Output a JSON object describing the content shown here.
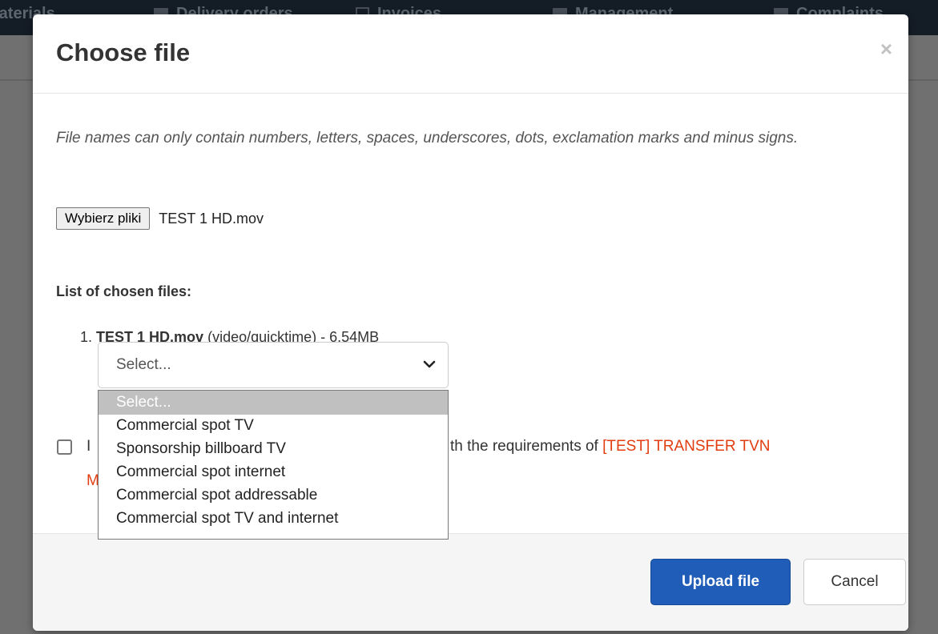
{
  "background_nav": {
    "items": [
      {
        "label": "Materials"
      },
      {
        "label": "Delivery orders"
      },
      {
        "label": "Invoices"
      },
      {
        "label": "Management"
      },
      {
        "label": "Complaints"
      }
    ]
  },
  "modal": {
    "title": "Choose file",
    "close_symbol": "×",
    "hint": "File names can only contain numbers, letters, spaces, underscores, dots, exclamation marks and minus signs.",
    "file_input": {
      "button_label": "Wybierz pliki",
      "chosen_name": "TEST 1 HD.mov"
    },
    "list_title": "List of chosen files:",
    "files": [
      {
        "index": "1.",
        "name": "TEST 1 HD.mov",
        "meta": "(video/quicktime) - 6.54MB",
        "type_select": {
          "selected": "Select...",
          "options": [
            "Select...",
            "Commercial spot TV",
            "Sponsorship billboard TV",
            "Commercial spot internet",
            "Commercial spot addressable",
            "Commercial spot TV and internet"
          ]
        }
      }
    ],
    "consent": {
      "visible_start": "I",
      "visible_middle": "th the requirements of",
      "link_text": "[TEST] TRANSFER TVN",
      "visible_second_line": "M"
    },
    "footer": {
      "upload_label": "Upload file",
      "cancel_label": "Cancel"
    }
  },
  "colors": {
    "primary_button": "#1f5db8",
    "link": "#e23d10",
    "overlay": "#6b6b6b"
  }
}
